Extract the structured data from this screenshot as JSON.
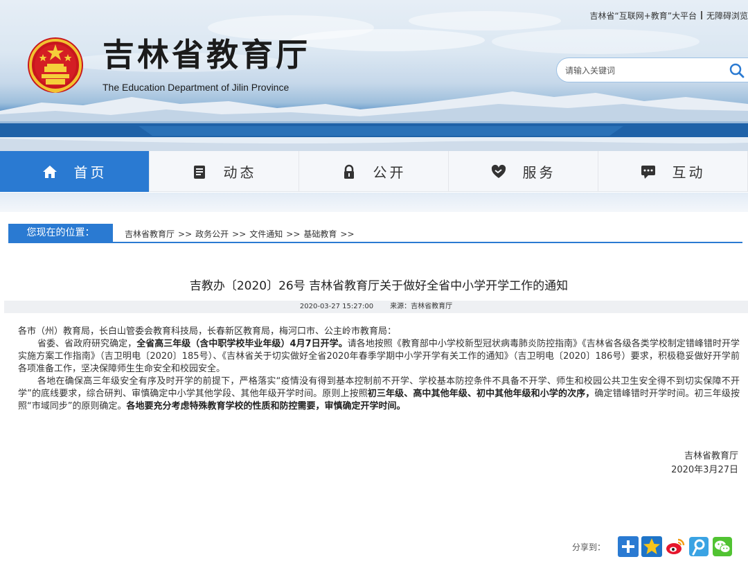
{
  "header": {
    "top_link_platform": "吉林省“互联网+教育”大平台",
    "top_link_accessible": "无障碍浏览",
    "site_title": "吉林省教育厅",
    "site_subtitle": "The Education Department of Jilin Province",
    "search": {
      "placeholder": "请输入关键词",
      "value": ""
    }
  },
  "nav": {
    "items": [
      {
        "label": "首页",
        "icon": "home-icon",
        "active": true
      },
      {
        "label": "动态",
        "icon": "news-icon",
        "active": false
      },
      {
        "label": "公开",
        "icon": "lock-icon",
        "active": false
      },
      {
        "label": "服务",
        "icon": "handshake-heart-icon",
        "active": false
      },
      {
        "label": "互动",
        "icon": "chat-icon",
        "active": false
      }
    ]
  },
  "breadcrumb": {
    "label": "您现在的位置：",
    "items": [
      "吉林省教育厅",
      "政务公开",
      "文件通知",
      "基础教育"
    ],
    "separator": ">>"
  },
  "article": {
    "title": "吉教办〔2020〕26号 吉林省教育厅关于做好全省中小学开学工作的通知",
    "date": "2020-03-27 15:27:00",
    "source": "来源：吉林省教育厅",
    "salutation": "各市（州）教育局，长白山管委会教育科技局，长春新区教育局，梅河口市、公主岭市教育局：",
    "p1_a": "省委、省政府研究确定，",
    "p1_bold": "全省高三年级（含中职学校毕业年级）4月7日开学。",
    "p1_b": "请各地按照《教育部中小学校新型冠状病毒肺炎防控指南》《吉林省各级各类学校制定错峰错时开学实施方案工作指南》（吉卫明电〔2020〕185号）、《吉林省关于切实做好全省2020年春季学期中小学开学有关工作的通知》（吉卫明电〔2020〕186号）要求，积极稳妥做好开学前各项准备工作，坚决保障师生生命安全和校园安全。",
    "p2_a": "各地在确保高三年级安全有序及时开学的前提下，严格落实“疫情没有得到基本控制前不开学、学校基本防控条件不具备不开学、师生和校园公共卫生安全得不到切实保障不开学”的底线要求，综合研判、审慎确定中小学其他学段、其他年级开学时间。原则上按照",
    "p2_bold1": "初三年级、高中其他年级、初中其他年级和小学的次序，",
    "p2_b": "确定错峰错时开学时间。初三年级按照“市域同步”的原则确定。",
    "p2_bold2": "各地要充分考虑特殊教育学校的性质和防控需要，审慎确定开学时间。",
    "signature": "吉林省教育厅",
    "sign_date": "2020年3月27日"
  },
  "share": {
    "label": "分享到：",
    "buttons": [
      "plus-icon",
      "qzone-star-icon",
      "weibo-icon",
      "tencent-weibo-icon",
      "wechat-icon"
    ]
  },
  "colors": {
    "accent": "#2a7ad2",
    "nav_bg": "#f5f7fa"
  }
}
